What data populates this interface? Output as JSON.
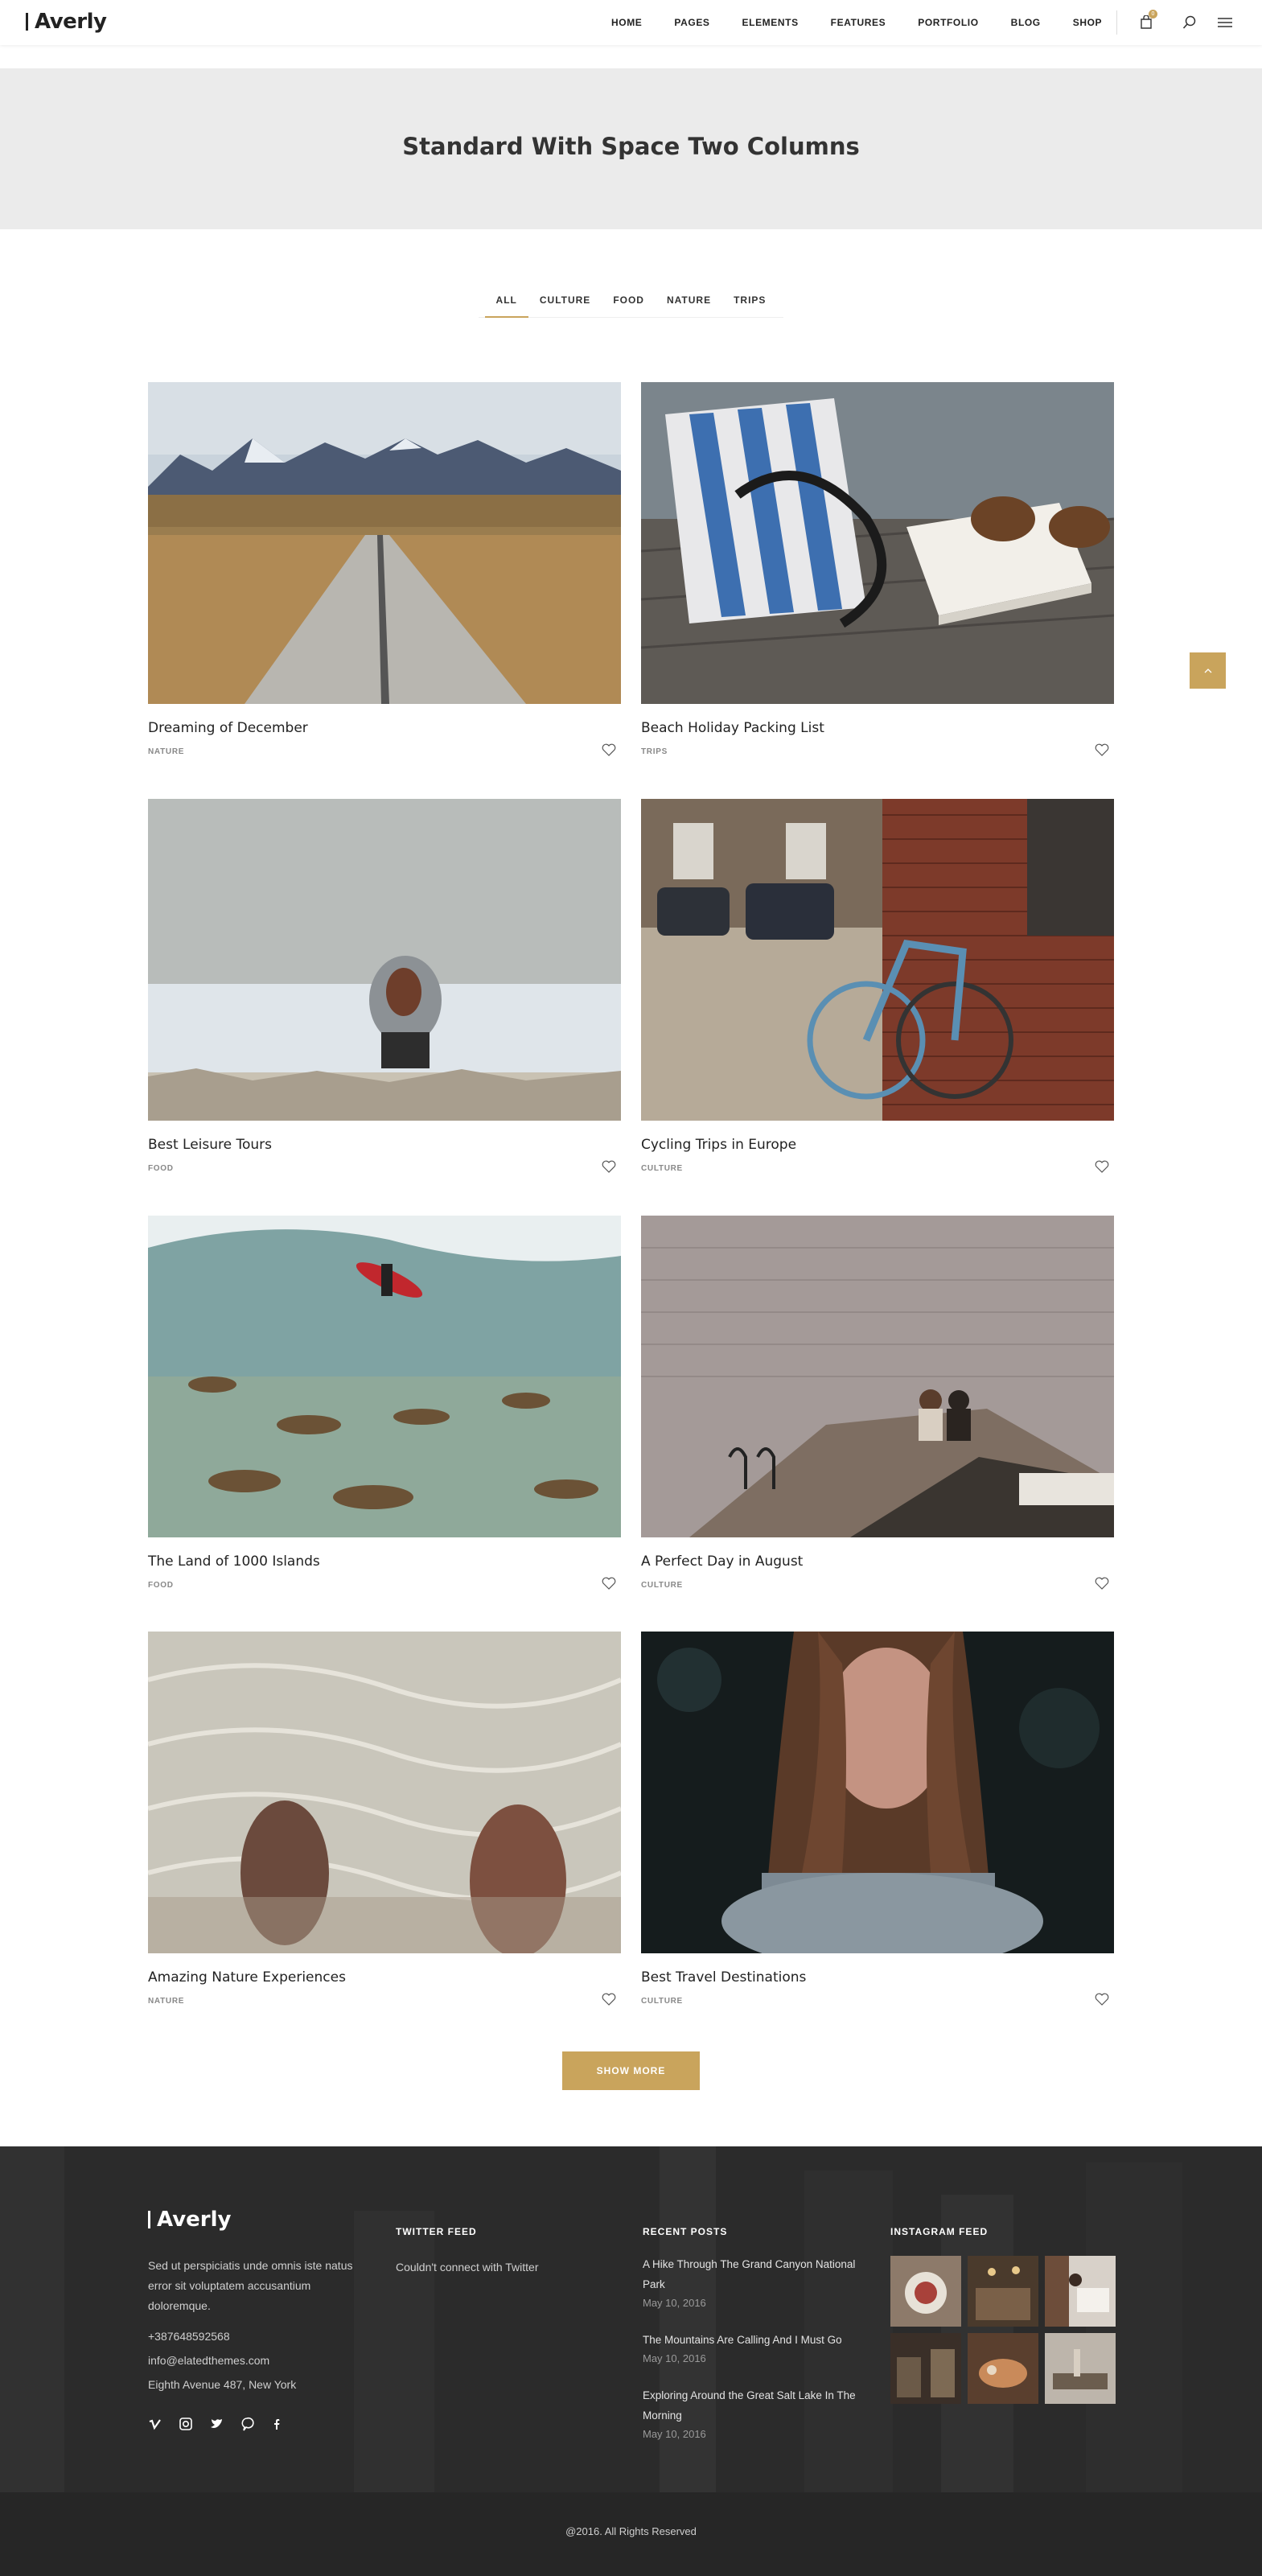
{
  "header": {
    "logo": "Averly",
    "nav": [
      "HOME",
      "PAGES",
      "ELEMENTS",
      "FEATURES",
      "PORTFOLIO",
      "BLOG",
      "SHOP"
    ],
    "cart_count": "0",
    "icons": [
      "cart-icon",
      "search-icon",
      "menu-icon"
    ]
  },
  "page": {
    "title": "Standard With Space Two Columns"
  },
  "filter": {
    "items": [
      "ALL",
      "CULTURE",
      "FOOD",
      "NATURE",
      "TRIPS"
    ],
    "active": "ALL"
  },
  "posts": [
    {
      "title": "Dreaming of December",
      "category": "NATURE"
    },
    {
      "title": "Beach Holiday Packing List",
      "category": "TRIPS"
    },
    {
      "title": "Best Leisure Tours",
      "category": "FOOD"
    },
    {
      "title": "Cycling Trips in Europe",
      "category": "CULTURE"
    },
    {
      "title": "The Land of 1000 Islands",
      "category": "FOOD"
    },
    {
      "title": "A Perfect Day in August",
      "category": "CULTURE"
    },
    {
      "title": "Amazing Nature Experiences",
      "category": "NATURE"
    },
    {
      "title": "Best Travel Destinations",
      "category": "CULTURE"
    }
  ],
  "show_more": "SHOW MORE",
  "footer": {
    "logo": "Averly",
    "about": "Sed ut perspiciatis unde omnis iste natus error sit voluptatem accusantium doloremque.",
    "phone": "+38764859256​8",
    "email": "info@elatedthemes.com",
    "address": "Eighth Avenue 487, New York",
    "social": [
      "vimeo-icon",
      "instagram-icon",
      "twitter-icon",
      "pinterest-icon",
      "facebook-icon"
    ],
    "twitter_heading": "TWITTER FEED",
    "twitter_text": "Couldn't connect with Twitter",
    "recent_heading": "RECENT POSTS",
    "recent_posts": [
      {
        "title": "A Hike Through The Grand Canyon National Park",
        "date": "May 10, 2016"
      },
      {
        "title": "The Mountains Are Calling And I Must Go",
        "date": "May 10, 2016"
      },
      {
        "title": "Exploring Around the Great Salt Lake In The Morning",
        "date": "May 10, 2016"
      }
    ],
    "instagram_heading": "INSTAGRAM FEED",
    "copyright": "@2016. All Rights Reserved"
  },
  "colors": {
    "accent": "#c9a45c",
    "title_band": "#ebebeb",
    "footer_bg": "#2b2b2b"
  }
}
